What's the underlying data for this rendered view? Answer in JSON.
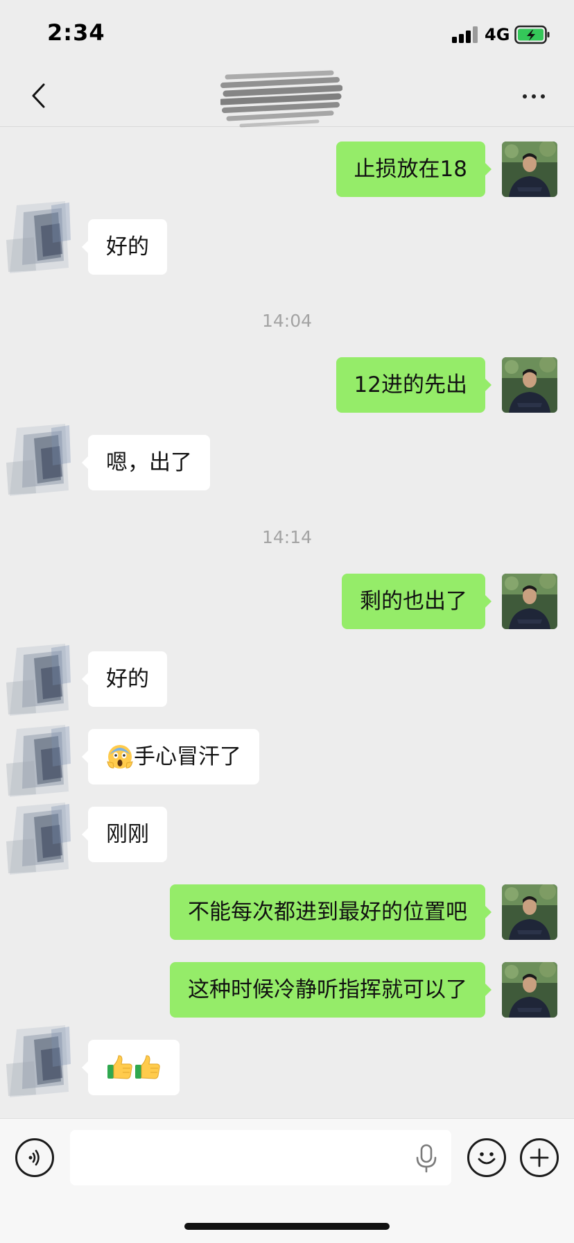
{
  "status_bar": {
    "time": "2:34",
    "network": "4G"
  },
  "nav": {
    "title": ""
  },
  "messages": {
    "m1": "止损放在18",
    "m2": "好的",
    "t1": "14:04",
    "m3": "12进的先出",
    "m4": "嗯，出了",
    "t2": "14:14",
    "m5": "剩的也出了",
    "m6": "好的",
    "m7": "手心冒汗了",
    "m8": "刚刚",
    "m9": "不能每次都进到最好的位置吧",
    "m10": "这种时候冷静听指挥就可以了"
  },
  "icons": {
    "emoji_scream": "face-screaming-in-fear-icon",
    "emoji_thumbs": "thumbs-up-icon"
  },
  "colors": {
    "background": "#ededed",
    "outgoing_bubble": "#95ec69",
    "incoming_bubble": "#ffffff",
    "battery": "#34c759"
  },
  "input": {
    "value": ""
  }
}
